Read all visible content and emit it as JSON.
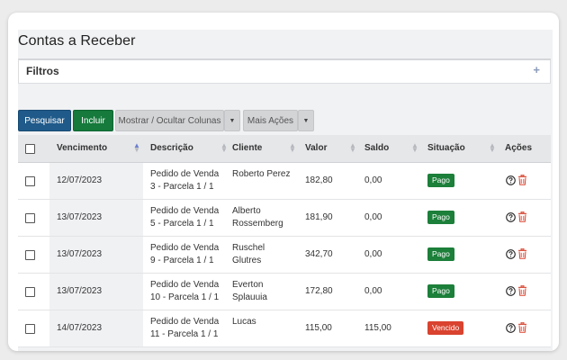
{
  "page": {
    "title": "Contas a Receber"
  },
  "filters": {
    "title": "Filtros",
    "toggle_icon": "plus-icon"
  },
  "toolbar": {
    "search_label": "Pesquisar",
    "add_label": "Incluir",
    "columns_label": "Mostrar / Ocultar Colunas",
    "more_label": "Mais Ações",
    "caret": "▼"
  },
  "table": {
    "headers": {
      "vencimento": "Vencimento",
      "descricao": "Descrição",
      "cliente": "Cliente",
      "valor": "Valor",
      "saldo": "Saldo",
      "situacao": "Situação",
      "acoes": "Ações"
    },
    "sorted_column": "vencimento",
    "rows": [
      {
        "vencimento": "12/07/2023",
        "descricao": "Pedido de Venda 3 - Parcela 1 / 1",
        "cliente": "Roberto Perez",
        "valor": "182,80",
        "saldo": "0,00",
        "situacao": "Pago",
        "status_kind": "pago"
      },
      {
        "vencimento": "13/07/2023",
        "descricao": "Pedido de Venda 5 - Parcela 1 / 1",
        "cliente": "Alberto Rossemberg",
        "valor": "181,90",
        "saldo": "0,00",
        "situacao": "Pago",
        "status_kind": "pago"
      },
      {
        "vencimento": "13/07/2023",
        "descricao": "Pedido de Venda 9 - Parcela 1 / 1",
        "cliente": "Ruschel Glutres",
        "valor": "342,70",
        "saldo": "0,00",
        "situacao": "Pago",
        "status_kind": "pago"
      },
      {
        "vencimento": "13/07/2023",
        "descricao": "Pedido de Venda 10 - Parcela 1 / 1",
        "cliente": "Everton Splauuia",
        "valor": "172,80",
        "saldo": "0,00",
        "situacao": "Pago",
        "status_kind": "pago"
      },
      {
        "vencimento": "14/07/2023",
        "descricao": "Pedido de Venda 11 - Parcela 1 / 1",
        "cliente": "Lucas",
        "valor": "115,00",
        "saldo": "115,00",
        "situacao": "Vencido",
        "status_kind": "vencido"
      }
    ]
  },
  "colors": {
    "primary": "#1f5a8a",
    "success": "#157a3c",
    "paid_badge": "#1c7f3a",
    "overdue_badge": "#d9432f",
    "delete_icon": "#d9432f"
  }
}
